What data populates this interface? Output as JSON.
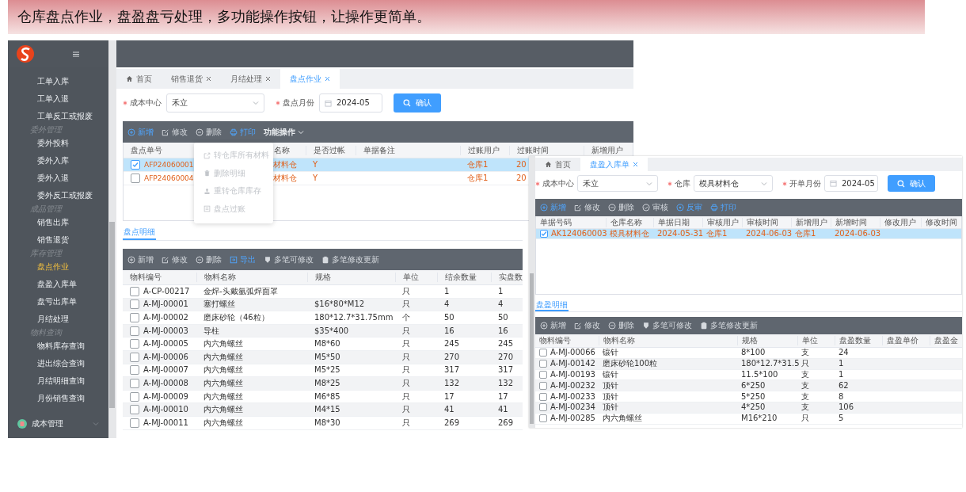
{
  "banner": {
    "text": "仓库盘点作业，盘盈盘亏处理，多功能操作按钮，让操作更简单。"
  },
  "windows": [
    {
      "sidebar": {
        "items": [
          {
            "kind": "item",
            "label": "工单入库",
            "selected": false
          },
          {
            "kind": "item",
            "label": "工单入退",
            "selected": false
          },
          {
            "kind": "item",
            "label": "工单反工或报废",
            "selected": false
          },
          {
            "kind": "group",
            "label": "委外管理",
            "selected": false
          },
          {
            "kind": "item",
            "label": "委外投料",
            "selected": false
          },
          {
            "kind": "item",
            "label": "委外入库",
            "selected": false
          },
          {
            "kind": "item",
            "label": "委外入退",
            "selected": false
          },
          {
            "kind": "item",
            "label": "委外反工或报废",
            "selected": false
          },
          {
            "kind": "group",
            "label": "成品管理",
            "selected": false
          },
          {
            "kind": "item",
            "label": "销售出库",
            "selected": false
          },
          {
            "kind": "item",
            "label": "销售退货",
            "selected": false
          },
          {
            "kind": "group",
            "label": "库存管理",
            "selected": false
          },
          {
            "kind": "item",
            "label": "盘点作业",
            "selected": true
          },
          {
            "kind": "item",
            "label": "盘盈入库单",
            "selected": false
          },
          {
            "kind": "item",
            "label": "盘亏出库单",
            "selected": false
          },
          {
            "kind": "item",
            "label": "月结处理",
            "selected": false
          },
          {
            "kind": "group",
            "label": "物料查询",
            "selected": false
          },
          {
            "kind": "item",
            "label": "物料库存查询",
            "selected": false
          },
          {
            "kind": "item",
            "label": "进出综合查询",
            "selected": false
          },
          {
            "kind": "item",
            "label": "月结明细查询",
            "selected": false
          },
          {
            "kind": "item",
            "label": "月份销售查询",
            "selected": false
          },
          {
            "kind": "module",
            "label": "成本管理",
            "selected": false
          }
        ]
      },
      "tabs": [
        {
          "kind": "home",
          "label": "首页",
          "closable": false,
          "selected": false
        },
        {
          "kind": "page",
          "label": "销售退货",
          "closable": true,
          "selected": false
        },
        {
          "kind": "page",
          "label": "月结处理",
          "closable": true,
          "selected": false
        },
        {
          "kind": "page",
          "label": "盘点作业",
          "closable": true,
          "selected": true
        }
      ],
      "filters": [
        {
          "kind": "select",
          "label": "成本中心",
          "required": true,
          "value": "禾立"
        },
        {
          "kind": "month",
          "label": "盘点月份",
          "required": true,
          "value": "2024-05"
        }
      ],
      "confirm_button": "确认",
      "toolbar": [
        {
          "kind": "add",
          "label": "新增",
          "highlighted": true
        },
        {
          "kind": "edit",
          "label": "修改",
          "highlighted": false
        },
        {
          "kind": "delete",
          "label": "删除",
          "highlighted": false
        },
        {
          "kind": "print",
          "label": "打印",
          "highlighted": true
        },
        {
          "kind": "menu",
          "label": "功能操作",
          "highlighted": false
        }
      ],
      "menu": [
        {
          "kind": "share",
          "label": "转仓库所有材料",
          "disabled": true
        },
        {
          "kind": "trash",
          "label": "删除明细",
          "disabled": true
        },
        {
          "kind": "stamp",
          "label": "重转仓库库存",
          "disabled": true
        },
        {
          "kind": "document",
          "label": "盘点过账",
          "disabled": true
        }
      ],
      "table": {
        "kind": "master",
        "columns": [
          "盘点单号",
          "名称",
          "是否过帐",
          "单据备注",
          "过账用户",
          "过账时间",
          "新增用户"
        ],
        "rows": [
          {
            "selected": true,
            "cells": [
              "AFP24060001",
              "材料仓",
              "Y",
              null,
              "仓库1",
              "20",
              null
            ]
          },
          {
            "selected": false,
            "cells": [
              "AFP24060004",
              "材料仓",
              "Y",
              null,
              "仓库1",
              "20",
              null
            ]
          }
        ]
      },
      "detail_tab": {
        "label": "盘点明细",
        "selected": true
      },
      "detail_toolbar": [
        {
          "kind": "add",
          "label": "新增",
          "highlighted": false
        },
        {
          "kind": "edit",
          "label": "修改",
          "highlighted": false
        },
        {
          "kind": "delete",
          "label": "删除",
          "highlighted": false
        },
        {
          "kind": "export",
          "label": "导出",
          "highlighted": true
        },
        {
          "kind": "multi",
          "label": "多笔可修改",
          "highlighted": false
        },
        {
          "kind": "save",
          "label": "多笔修改更新",
          "highlighted": false
        }
      ],
      "detail_table": {
        "kind": "detail",
        "columns": [
          "物料编号",
          "物料名称",
          "规格",
          "单位",
          "结余数量",
          "实盘数"
        ],
        "rows": [
          {
            "selected": false,
            "cells": [
              "A-CP-00217",
              "金焊-头戴氩弧焊面罩",
              null,
              "只",
              "1",
              "1"
            ]
          },
          {
            "selected": false,
            "cells": [
              "A-MJ-00001",
              "塞打螺丝",
              "$16*80*M12",
              "只",
              "4",
              "4"
            ]
          },
          {
            "selected": false,
            "cells": [
              "A-MJ-00002",
              "磨床砂轮（46粒）",
              "180*12.7*31.75mm",
              "个",
              "50",
              "50"
            ]
          },
          {
            "selected": false,
            "cells": [
              "A-MJ-00003",
              "导柱",
              "$35*400",
              "只",
              "16",
              "16"
            ]
          },
          {
            "selected": false,
            "cells": [
              "A-MJ-00005",
              "内六角螺丝",
              "M8*60",
              "只",
              "245",
              "245"
            ]
          },
          {
            "selected": false,
            "cells": [
              "A-MJ-00006",
              "内六角螺丝",
              "M5*50",
              "只",
              "270",
              "270"
            ]
          },
          {
            "selected": false,
            "cells": [
              "A-MJ-00007",
              "内六角螺丝",
              "M5*25",
              "只",
              "317",
              "317"
            ]
          },
          {
            "selected": false,
            "cells": [
              "A-MJ-00008",
              "内六角螺丝",
              "M8*25",
              "只",
              "132",
              "132"
            ]
          },
          {
            "selected": false,
            "cells": [
              "A-MJ-00009",
              "内六角螺丝",
              "M6*85",
              "只",
              "17",
              "17"
            ]
          },
          {
            "selected": false,
            "cells": [
              "A-MJ-00010",
              "内六角螺丝",
              "M4*15",
              "只",
              "41",
              "41"
            ]
          },
          {
            "selected": false,
            "cells": [
              "A-MJ-00011",
              "内六角螺丝",
              "M8*30",
              "只",
              "269",
              "269"
            ]
          }
        ]
      }
    },
    {
      "tabs": [
        {
          "kind": "home",
          "label": "首页",
          "closable": false,
          "selected": false
        },
        {
          "kind": "page",
          "label": "盘盈入库单",
          "closable": true,
          "selected": true
        }
      ],
      "filters": [
        {
          "kind": "select",
          "label": "成本中心",
          "required": true,
          "value": "禾立"
        },
        {
          "kind": "select",
          "label": "仓库",
          "required": true,
          "value": "模具材料仓"
        },
        {
          "kind": "month",
          "label": "开单月份",
          "required": true,
          "value": "2024-05"
        }
      ],
      "confirm_button": "确认",
      "toolbar": [
        {
          "kind": "add",
          "label": "新增",
          "highlighted": true
        },
        {
          "kind": "edit",
          "label": "修改",
          "highlighted": false
        },
        {
          "kind": "delete",
          "label": "删除",
          "highlighted": false
        },
        {
          "kind": "audit",
          "label": "审核",
          "highlighted": false
        },
        {
          "kind": "unaudit",
          "label": "反审",
          "highlighted": true
        },
        {
          "kind": "print",
          "label": "打印",
          "highlighted": true
        }
      ],
      "table": {
        "kind": "master",
        "columns": [
          "单据号码",
          "仓库名称",
          "单据日期",
          "审核用户",
          "审核时间",
          "新增用户",
          "新增时间",
          "修改用户",
          "修改时间"
        ],
        "rows": [
          {
            "selected": true,
            "cells": [
              "AK124060003",
              "模具材料仓",
              "2024-05-31",
              "仓库1",
              "2024-06-03",
              "仓库1",
              "2024-06-03",
              null,
              null
            ]
          }
        ]
      },
      "detail_tab": {
        "label": "盘盈明细",
        "selected": true
      },
      "detail_toolbar": [
        {
          "kind": "add",
          "label": "新增",
          "highlighted": false
        },
        {
          "kind": "edit",
          "label": "修改",
          "highlighted": false
        },
        {
          "kind": "delete",
          "label": "删除",
          "highlighted": false
        },
        {
          "kind": "multi",
          "label": "多笔可修改",
          "highlighted": false
        },
        {
          "kind": "save",
          "label": "多笔修改更新",
          "highlighted": false
        }
      ],
      "detail_table": {
        "kind": "detail",
        "columns": [
          "物料编号",
          "物料名称",
          "规格",
          "单位",
          "盘盈数量",
          "盘盈单价",
          "盘盈金"
        ],
        "rows": [
          {
            "selected": false,
            "cells": [
              "A-MJ-00066",
              "镶针",
              "8*100",
              "支",
              "24",
              null,
              null
            ]
          },
          {
            "selected": false,
            "cells": [
              "A-MJ-00142",
              "磨床砂轮100粒",
              "180*12.7*31.5",
              "只",
              "1",
              null,
              null
            ]
          },
          {
            "selected": false,
            "cells": [
              "A-MJ-00193",
              "镶针",
              "11.5*100",
              "支",
              "1",
              null,
              null
            ]
          },
          {
            "selected": false,
            "cells": [
              "A-MJ-00232",
              "顶针",
              "6*250",
              "支",
              "62",
              null,
              null
            ]
          },
          {
            "selected": false,
            "cells": [
              "A-MJ-00233",
              "顶针",
              "5*250",
              "支",
              "8",
              null,
              null
            ]
          },
          {
            "selected": false,
            "cells": [
              "A-MJ-00234",
              "顶针",
              "4*250",
              "支",
              "106",
              null,
              null
            ]
          },
          {
            "selected": false,
            "cells": [
              "A-MJ-00285",
              "内六角螺丝",
              "M16*210",
              "只",
              "5",
              null,
              null
            ]
          }
        ]
      }
    }
  ]
}
